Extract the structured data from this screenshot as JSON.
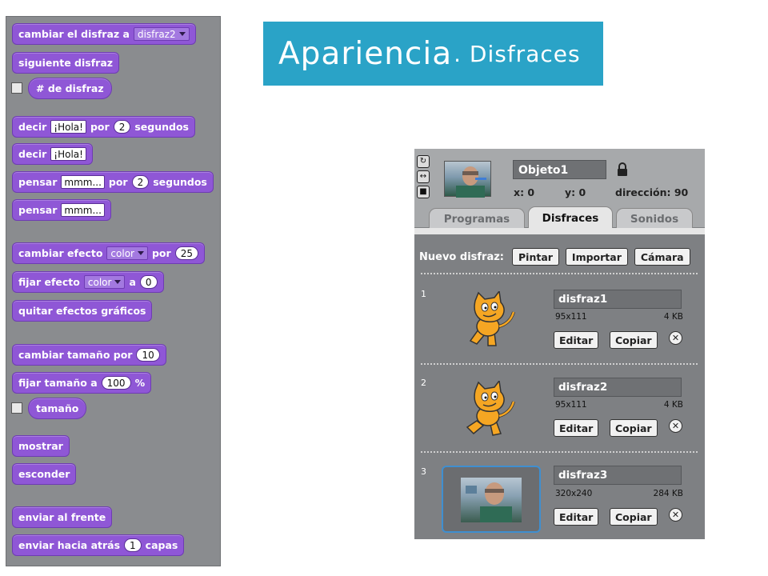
{
  "palette": {
    "blocks": [
      {
        "label": "cambiar el disfraz a",
        "dropdown": "disfraz2"
      },
      {
        "label": "siguiente disfraz"
      },
      {
        "label": "# de disfraz"
      },
      {
        "label": "decir",
        "input": "¡Hola!",
        "mid": "por",
        "num": "2",
        "tail": "segundos"
      },
      {
        "label": "decir",
        "input": "¡Hola!"
      },
      {
        "label": "pensar",
        "input": "mmm...",
        "mid": "por",
        "num": "2",
        "tail": "segundos"
      },
      {
        "label": "pensar",
        "input": "mmm..."
      },
      {
        "label": "cambiar efecto",
        "dropdown": "color",
        "mid": "por",
        "num": "25"
      },
      {
        "label": "fijar efecto",
        "dropdown": "color",
        "mid": "a",
        "num": "0"
      },
      {
        "label": "quitar efectos gráficos"
      },
      {
        "label": "cambiar tamaño por",
        "num": "10"
      },
      {
        "label": "fijar tamaño a",
        "num": "100",
        "tail": "%"
      },
      {
        "label": "tamaño"
      },
      {
        "label": "mostrar"
      },
      {
        "label": "esconder"
      },
      {
        "label": "enviar al frente"
      },
      {
        "label": "enviar hacia atrás",
        "num": "1",
        "tail": "capas"
      }
    ]
  },
  "banner": {
    "title": "Apariencia",
    "subtitle": ". Disfraces"
  },
  "panel": {
    "object_name": "Objeto1",
    "x_label": "x:",
    "x_value": "0",
    "y_label": "y:",
    "y_value": "0",
    "dir_label": "dirección:",
    "dir_value": "90",
    "tabs": [
      "Programas",
      "Disfraces",
      "Sonidos"
    ],
    "new_costume_label": "Nuevo disfraz:",
    "new_buttons": [
      "Pintar",
      "Importar",
      "Cámara"
    ],
    "costumes": [
      {
        "index": "1",
        "name": "disfraz1",
        "size": "95x111",
        "kb": "4 KB"
      },
      {
        "index": "2",
        "name": "disfraz2",
        "size": "95x111",
        "kb": "4 KB"
      },
      {
        "index": "3",
        "name": "disfraz3",
        "size": "320x240",
        "kb": "284 KB"
      }
    ],
    "edit_label": "Editar",
    "copy_label": "Copiar"
  },
  "colors": {
    "looks_block": "#8f57d6",
    "banner": "#2aa3c7",
    "panel": "#7e8083"
  }
}
